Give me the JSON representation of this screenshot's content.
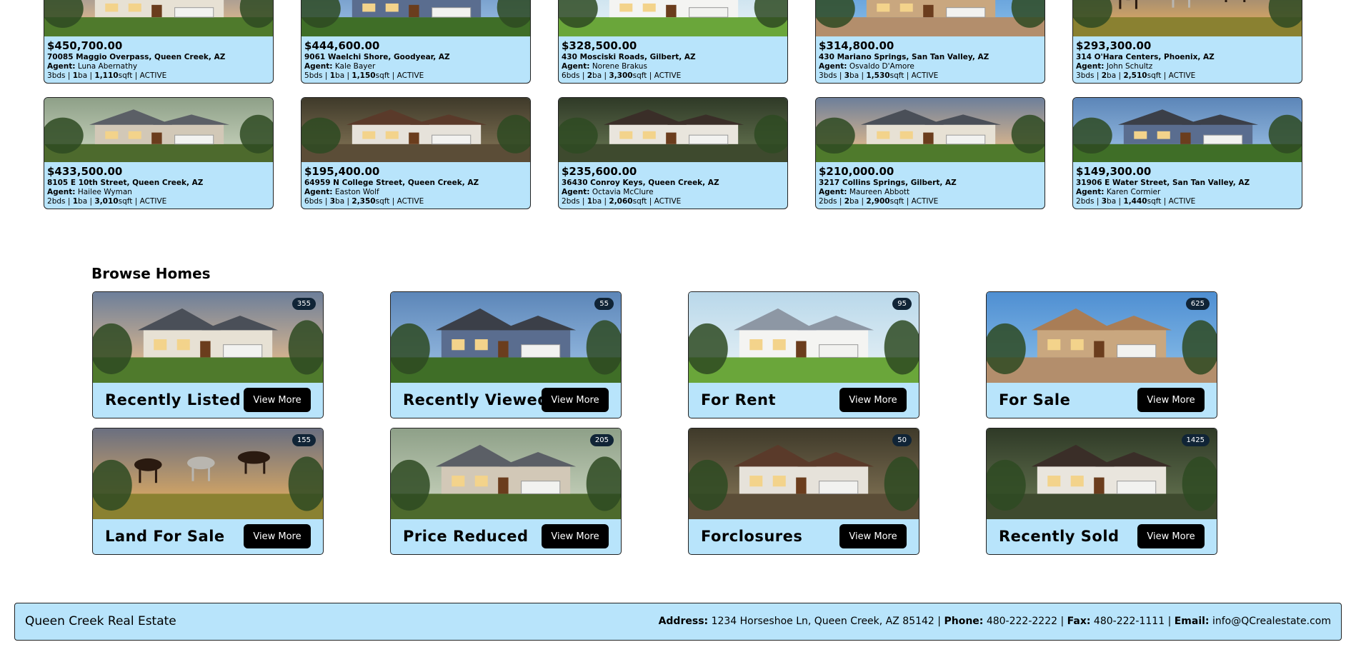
{
  "listings": [
    {
      "price": "$450,700.00",
      "address": "70085 Maggio Overpass, Queen Creek, AZ",
      "agent_label": "Agent:",
      "agent": "Luna Abernathy",
      "beds": "3",
      "baths": "1",
      "sqft": "1,110",
      "status": "ACTIVE"
    },
    {
      "price": "$444,600.00",
      "address": "9061 Waelchi Shore, Goodyear, AZ",
      "agent_label": "Agent:",
      "agent": "Kale Bayer",
      "beds": "5",
      "baths": "1",
      "sqft": "1,150",
      "status": "ACTIVE"
    },
    {
      "price": "$328,500.00",
      "address": "430 Mosciski Roads, Gilbert, AZ",
      "agent_label": "Agent:",
      "agent": "Norene Brakus",
      "beds": "6",
      "baths": "2",
      "sqft": "3,300",
      "status": "ACTIVE"
    },
    {
      "price": "$314,800.00",
      "address": "430 Mariano Springs, San Tan Valley, AZ",
      "agent_label": "Agent:",
      "agent": "Osvaldo D'Amore",
      "beds": "3",
      "baths": "3",
      "sqft": "1,530",
      "status": "ACTIVE"
    },
    {
      "price": "$293,300.00",
      "address": "314 O'Hara Centers, Phoenix, AZ",
      "agent_label": "Agent:",
      "agent": "John Schultz",
      "beds": "3",
      "baths": "2",
      "sqft": "2,510",
      "status": "ACTIVE"
    },
    {
      "price": "$433,500.00",
      "address": "8105 E 10th Street, Queen Creek, AZ",
      "agent_label": "Agent:",
      "agent": "Hailee Wyman",
      "beds": "2",
      "baths": "1",
      "sqft": "3,010",
      "status": "ACTIVE"
    },
    {
      "price": "$195,400.00",
      "address": "64959 N College Street, Queen Creek, AZ",
      "agent_label": "Agent:",
      "agent": "Easton Wolf",
      "beds": "6",
      "baths": "3",
      "sqft": "2,350",
      "status": "ACTIVE"
    },
    {
      "price": "$235,600.00",
      "address": "36430 Conroy Keys, Queen Creek, AZ",
      "agent_label": "Agent:",
      "agent": "Octavia McClure",
      "beds": "2",
      "baths": "1",
      "sqft": "2,060",
      "status": "ACTIVE"
    },
    {
      "price": "$210,000.00",
      "address": "3217 Collins Springs, Gilbert, AZ",
      "agent_label": "Agent:",
      "agent": "Maureen Abbott",
      "beds": "2",
      "baths": "2",
      "sqft": "2,900",
      "status": "ACTIVE"
    },
    {
      "price": "$149,300.00",
      "address": "31906 E Water Street, San Tan Valley, AZ",
      "agent_label": "Agent:",
      "agent": "Karen Cormier",
      "beds": "2",
      "baths": "3",
      "sqft": "1,440",
      "status": "ACTIVE"
    }
  ],
  "units": {
    "beds": "bds",
    "baths": "ba",
    "sqft": "sqft",
    "sep": "|"
  },
  "browse": {
    "title": "Browse Homes",
    "button_label": "View More",
    "categories": [
      {
        "title": "Recently Listed",
        "count": "355"
      },
      {
        "title": "Recently Viewed",
        "count": "55"
      },
      {
        "title": "For Rent",
        "count": "95"
      },
      {
        "title": "For Sale",
        "count": "625"
      },
      {
        "title": "Land For Sale",
        "count": "155"
      },
      {
        "title": "Price Reduced",
        "count": "205"
      },
      {
        "title": "Forclosures",
        "count": "50"
      },
      {
        "title": "Recently Sold",
        "count": "1425"
      }
    ]
  },
  "footer": {
    "brand": "Queen Creek Real Estate",
    "address_label": "Address:",
    "address": "1234 Horseshoe Ln, Queen Creek, AZ 85142",
    "phone_label": "Phone:",
    "phone": "480-222-2222",
    "fax_label": "Fax:",
    "fax": "480-222-1111",
    "email_label": "Email:",
    "email": "info@QCrealestate.com",
    "sep": "|"
  },
  "colors": {
    "card_bg": "#b8e4fb",
    "button_bg": "#000000",
    "badge_bg": "#102436"
  }
}
